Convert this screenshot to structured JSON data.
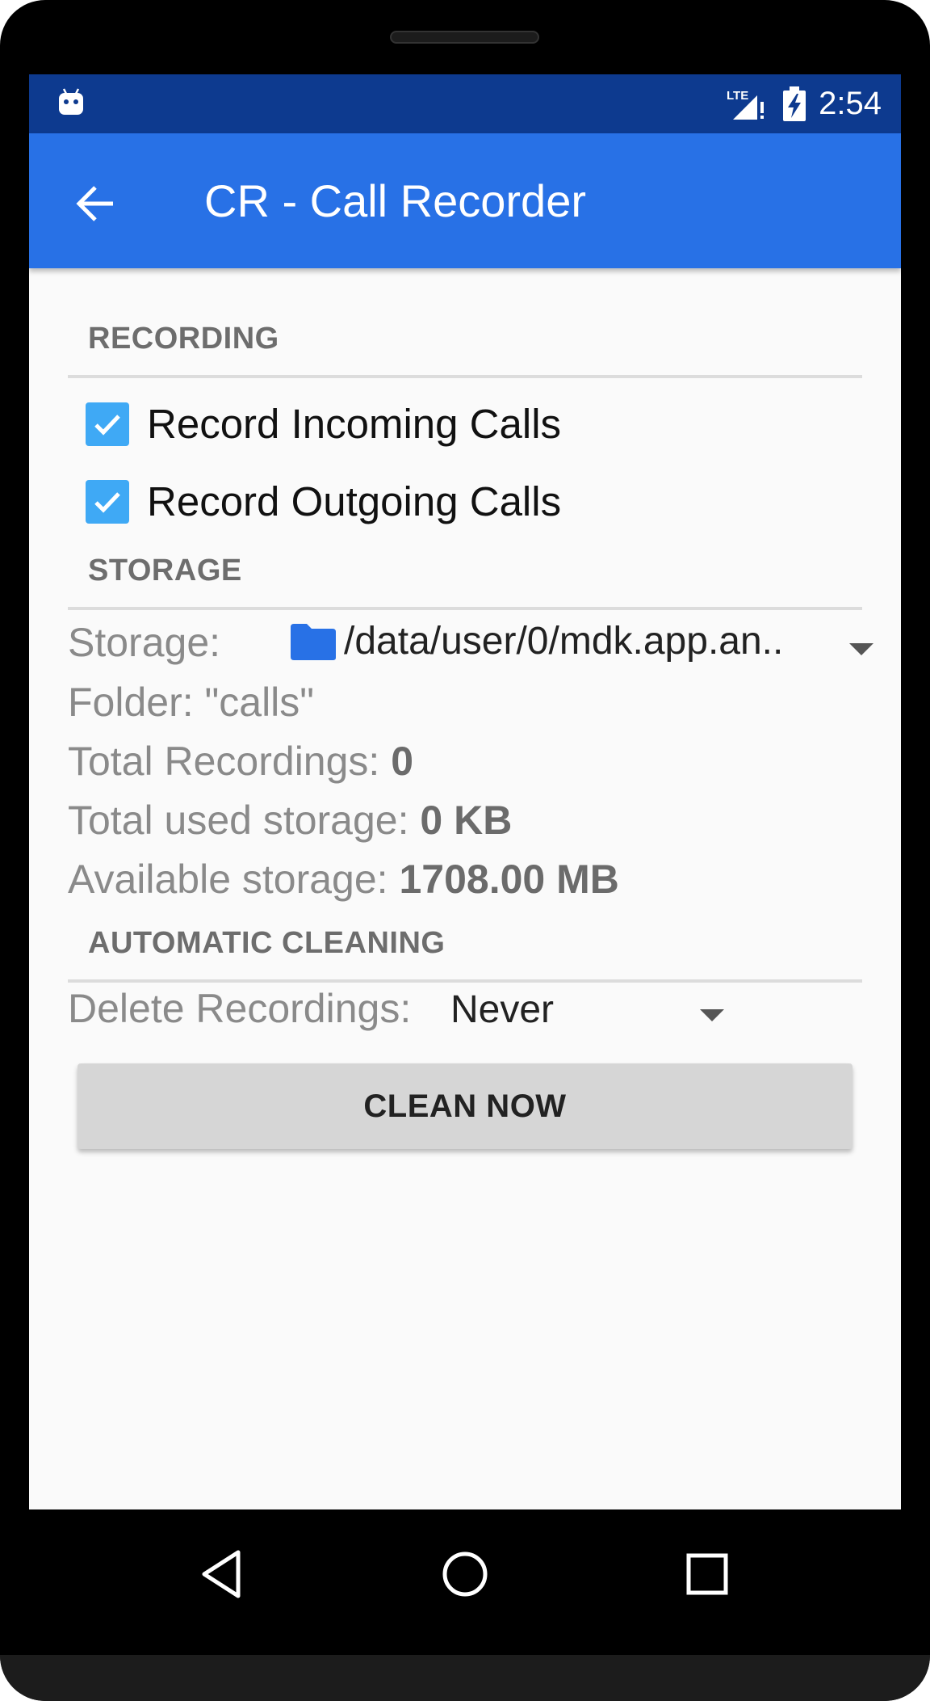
{
  "status_bar": {
    "network": "LTE",
    "time": "2:54"
  },
  "app_bar": {
    "title": "CR - Call Recorder"
  },
  "recording": {
    "header": "RECORDING",
    "incoming_label": "Record Incoming Calls",
    "incoming_checked": true,
    "outgoing_label": "Record Outgoing Calls",
    "outgoing_checked": true
  },
  "storage": {
    "header": "STORAGE",
    "storage_label": "Storage:",
    "storage_path": "/data/user/0/mdk.app.an..",
    "folder_line": "Folder: \"calls\"",
    "total_recordings_label": "Total Recordings:",
    "total_recordings_value": "0",
    "used_storage_label": "Total used storage:",
    "used_storage_value": "0 KB",
    "available_label": "Available storage:",
    "available_value": "1708.00 MB"
  },
  "cleaning": {
    "header": "AUTOMATIC CLEANING",
    "delete_label": "Delete Recordings:",
    "delete_value": "Never",
    "clean_button": "CLEAN NOW"
  },
  "colors": {
    "status_bar": "#0d3a8f",
    "app_bar": "#2871e6",
    "checkbox": "#3fa9f5",
    "folder": "#2871e6"
  },
  "icons": [
    "android-icon",
    "lte-signal-icon",
    "battery-charging-icon",
    "back-arrow-icon",
    "checkbox-checked-icon",
    "folder-icon",
    "dropdown-arrow-icon",
    "nav-back-icon",
    "nav-home-icon",
    "nav-recents-icon"
  ]
}
